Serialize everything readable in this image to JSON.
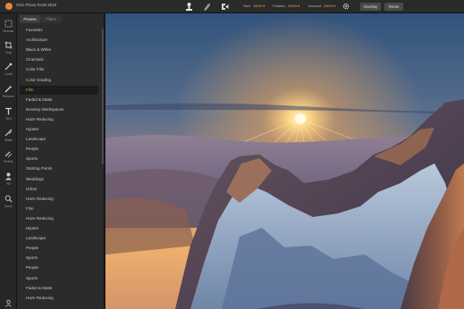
{
  "app": {
    "title": "ON1 Photo RAW 2019"
  },
  "toolbar": {
    "size": {
      "label": "Size:",
      "value": "100%"
    },
    "feather": {
      "label": "Feather:",
      "value": "100%"
    },
    "amount": {
      "label": "Amount:",
      "value": "100%"
    },
    "overlay_label": "Overlay",
    "reset_label": "Reset"
  },
  "rail": {
    "items": [
      {
        "icon": "browse-icon",
        "label": "Browse"
      },
      {
        "icon": "crop-icon",
        "label": "Crop"
      },
      {
        "icon": "local-icon",
        "label": "Local"
      },
      {
        "icon": "retouch-icon",
        "label": "Retouch"
      },
      {
        "icon": "text-icon",
        "label": "Text"
      },
      {
        "icon": "mask-icon",
        "label": "Mask"
      },
      {
        "icon": "refine-icon",
        "label": "Refine"
      },
      {
        "icon": "fill-icon",
        "label": "Fill"
      },
      {
        "icon": "zoom-icon",
        "label": "Zoom"
      }
    ]
  },
  "panel": {
    "tabs": [
      {
        "label": "Presets",
        "active": true
      },
      {
        "label": "Filters",
        "active": false
      }
    ],
    "selected_index": 6,
    "items": [
      "Favorites",
      "Architecture",
      "Black & White",
      "Cinematic",
      "Color Film",
      "Color Grading",
      "Film",
      "Faded & Matte",
      "Develop Workspaces",
      "Haze Reducing",
      "Hipster",
      "Landscape",
      "People",
      "Sports",
      "Starting Points",
      "Weddings",
      "Urban",
      "Haze Reducing",
      "Film",
      "Haze Reducing",
      "Hipster",
      "Landscape",
      "People",
      "Sports",
      "People",
      "Sports",
      "Faded & Matte",
      "Haze Reducing"
    ]
  },
  "colors": {
    "accent": "#e8a94d",
    "selected_text": "#e7a85a"
  }
}
